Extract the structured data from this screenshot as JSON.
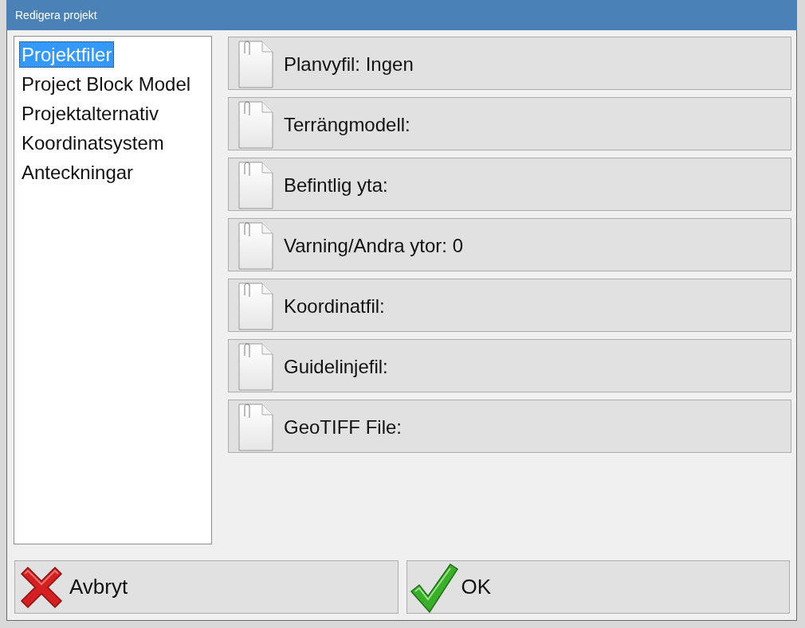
{
  "window": {
    "title": "Redigera projekt"
  },
  "sidebar": {
    "items": [
      {
        "label": "Projektfiler",
        "selected": true
      },
      {
        "label": "Project Block Model",
        "selected": false
      },
      {
        "label": "Projektalternativ",
        "selected": false
      },
      {
        "label": "Koordinatsystem",
        "selected": false
      },
      {
        "label": "Anteckningar",
        "selected": false
      }
    ]
  },
  "files": [
    {
      "label": "Planvyfil: Ingen"
    },
    {
      "label": "Terrängmodell:"
    },
    {
      "label": "Befintlig yta:"
    },
    {
      "label": "Varning/Andra ytor: 0"
    },
    {
      "label": "Koordinatfil:"
    },
    {
      "label": "Guidelinjefil:"
    },
    {
      "label": "GeoTIFF File:"
    }
  ],
  "buttons": [
    {
      "label": "Avbryt",
      "kind": "cancel"
    },
    {
      "label": "OK",
      "kind": "ok"
    }
  ]
}
